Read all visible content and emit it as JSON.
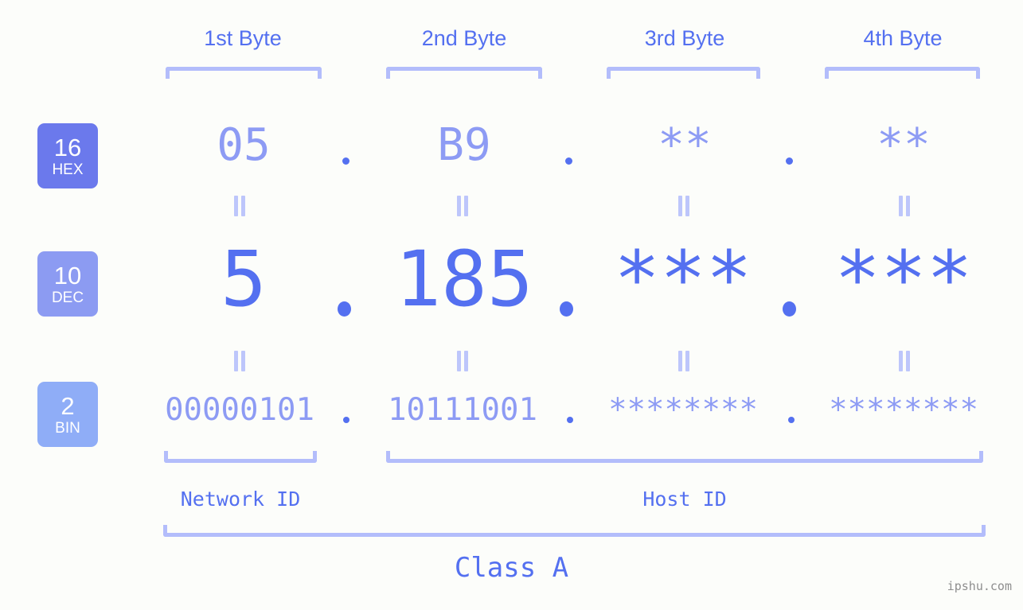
{
  "watermark": "ipshu.com",
  "byte_headers": [
    {
      "label": "1st Byte"
    },
    {
      "label": "2nd Byte"
    },
    {
      "label": "3rd Byte"
    },
    {
      "label": "4th Byte"
    }
  ],
  "bases": [
    {
      "radix": "16",
      "name": "HEX",
      "color": "#6b79ec"
    },
    {
      "radix": "10",
      "name": "DEC",
      "color": "#8c9bf2"
    },
    {
      "radix": "2",
      "name": "BIN",
      "color": "#8fadf7"
    }
  ],
  "rows": {
    "hex": {
      "values": [
        "05",
        "B9",
        "**",
        "**"
      ],
      "separator": "."
    },
    "dec": {
      "values": [
        "5",
        "185",
        "***",
        "***"
      ],
      "separator": "."
    },
    "bin": {
      "values": [
        "00000101",
        "10111001",
        "********",
        "********"
      ],
      "separator": "."
    }
  },
  "equality_marks": {
    "glyph": "="
  },
  "segments": {
    "network_id": "Network ID",
    "host_id": "Host ID",
    "class": "Class A"
  },
  "colors": {
    "background": "#fcfdfa",
    "accent_strong": "#5470f0",
    "accent_light": "#8d9bf4",
    "bracket": "#b3bdfb",
    "watermark": "#8e8e8e"
  }
}
